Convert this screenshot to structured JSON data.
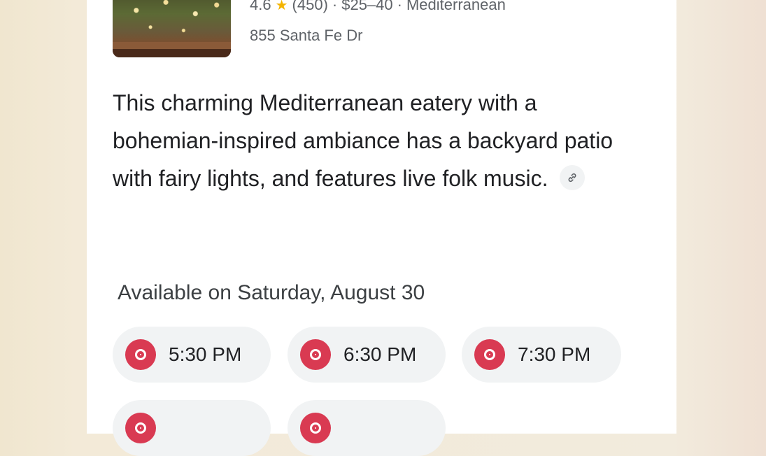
{
  "restaurant": {
    "rating": "4.6",
    "rating_icon": "star-icon",
    "reviews": "(450)",
    "price": "$25–40",
    "cuisine": "Mediterranean",
    "separator": "·",
    "address": "855 Santa Fe Dr",
    "description": "This charming Mediterranean eatery with a bohemian-inspired ambiance has a backyard patio with fairy lights, and features live folk music."
  },
  "availability": {
    "heading": "Available on Saturday, August 30",
    "slots": [
      "5:30 PM",
      "6:30 PM",
      "7:30 PM",
      "",
      ""
    ]
  },
  "colors": {
    "accent": "#d93a52",
    "chip_bg": "#f1f3f4",
    "text_primary": "#202124",
    "text_secondary": "#5f6368"
  }
}
